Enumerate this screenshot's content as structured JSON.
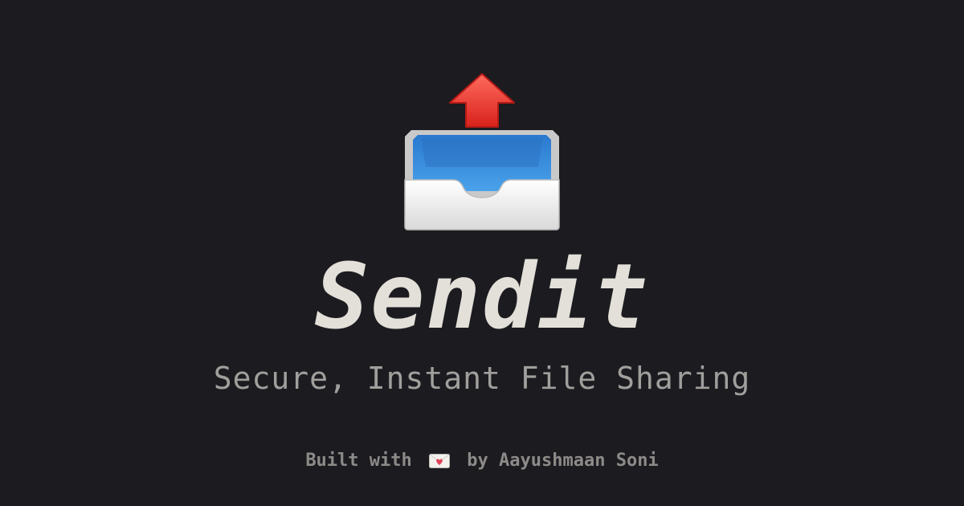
{
  "brand": {
    "title": "Sendit",
    "tagline": "Secure, Instant File Sharing",
    "logo_icon": "outbox-tray-icon"
  },
  "footer": {
    "prefix": "Built with",
    "icon": "love-letter-icon",
    "suffix": "by Aayushmaan Soni"
  },
  "colors": {
    "background": "#1c1b20",
    "title": "#e2e0d8",
    "subtitle": "#a19f9c",
    "footer": "#8d8b88",
    "arrow": "#e8322c",
    "tray_inner": "#3b8fd9"
  }
}
